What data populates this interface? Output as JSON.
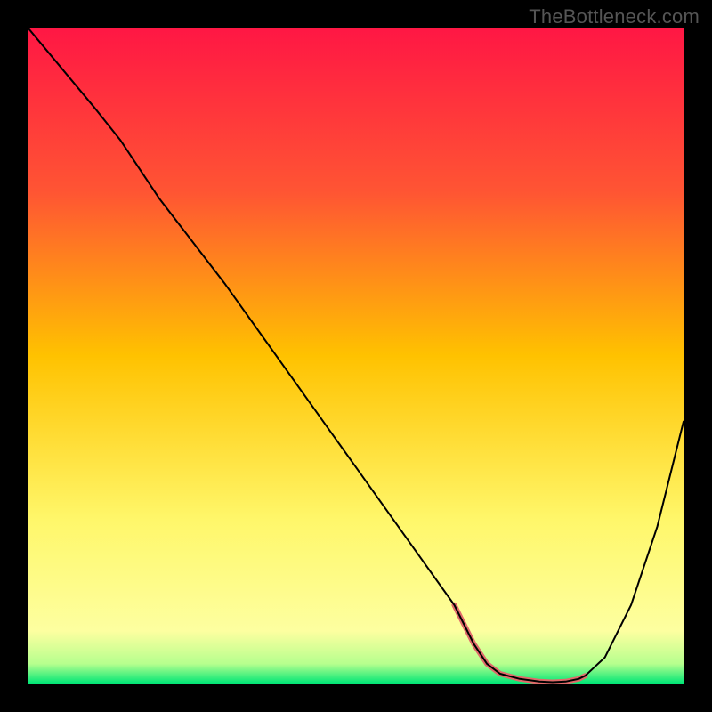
{
  "watermark": "TheBottleneck.com",
  "chart_data": {
    "type": "line",
    "title": "",
    "xlabel": "",
    "ylabel": "",
    "xlim": [
      0,
      100
    ],
    "ylim": [
      0,
      100
    ],
    "background": {
      "type": "vertical-gradient",
      "stops": [
        {
          "pos": 0.0,
          "color": "#ff1744"
        },
        {
          "pos": 0.25,
          "color": "#ff5533"
        },
        {
          "pos": 0.5,
          "color": "#ffc200"
        },
        {
          "pos": 0.75,
          "color": "#fff76a"
        },
        {
          "pos": 0.92,
          "color": "#fdffa0"
        },
        {
          "pos": 0.97,
          "color": "#b6ff8e"
        },
        {
          "pos": 1.0,
          "color": "#00e676"
        }
      ]
    },
    "series": [
      {
        "name": "curve",
        "color": "#000000",
        "width": 2,
        "x": [
          0,
          5,
          10,
          14,
          20,
          30,
          40,
          50,
          60,
          65,
          68,
          70,
          72,
          75,
          78,
          80,
          82,
          84,
          85,
          88,
          92,
          96,
          100
        ],
        "y": [
          100,
          94,
          88,
          83,
          74,
          61,
          47,
          33,
          19,
          12,
          6,
          3,
          1.5,
          0.7,
          0.3,
          0.2,
          0.3,
          0.7,
          1.2,
          4,
          12,
          24,
          40
        ]
      },
      {
        "name": "highlight",
        "color": "#e06a6a",
        "width": 6,
        "x": [
          65,
          68,
          70,
          72,
          75,
          78,
          80,
          82,
          84,
          85
        ],
        "y": [
          12,
          6,
          3,
          1.5,
          0.7,
          0.3,
          0.2,
          0.3,
          0.7,
          1.2
        ]
      }
    ]
  }
}
